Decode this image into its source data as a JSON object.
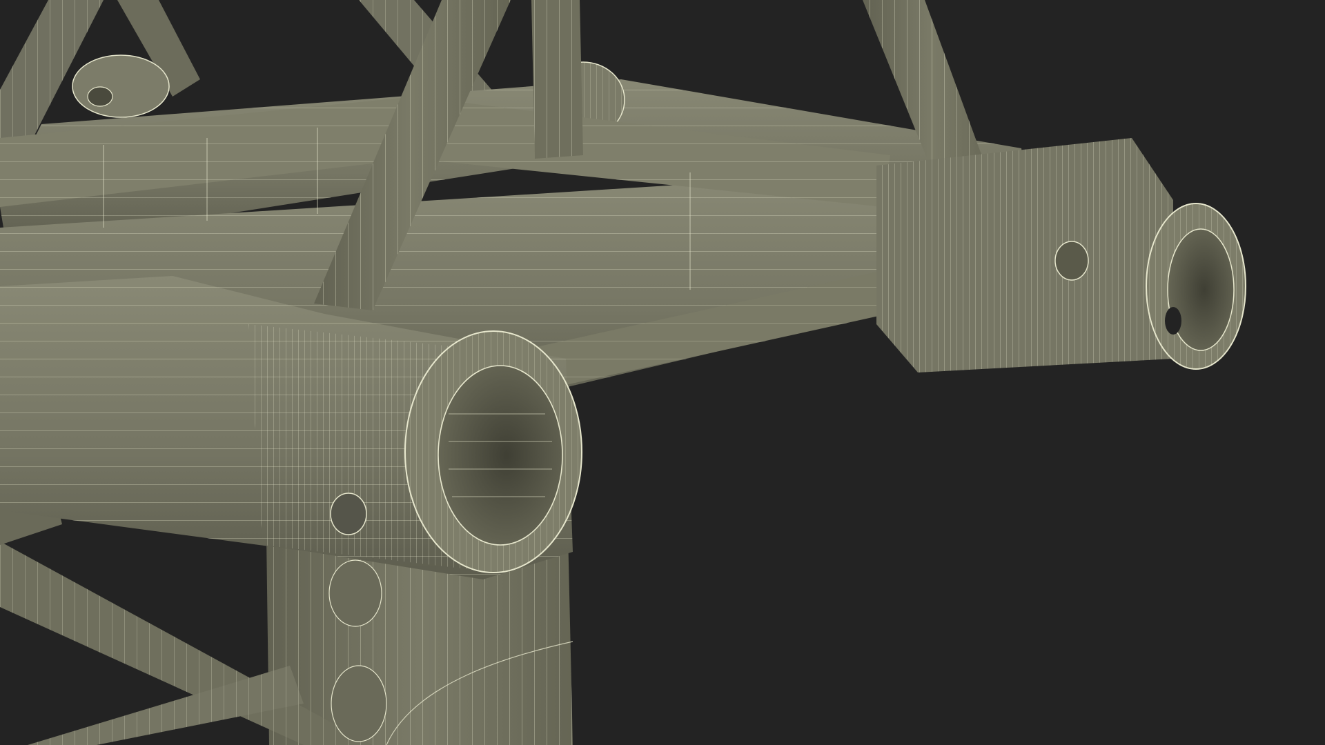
{
  "scene": {
    "subject": "truss-corner-junction-wireframe",
    "colors": {
      "background": "#232323",
      "surface": "#767664",
      "surface_light": "#858571",
      "surface_dark": "#5b5b4c",
      "inner": "#4a4a3d",
      "wire": "#e6e6cc"
    }
  }
}
